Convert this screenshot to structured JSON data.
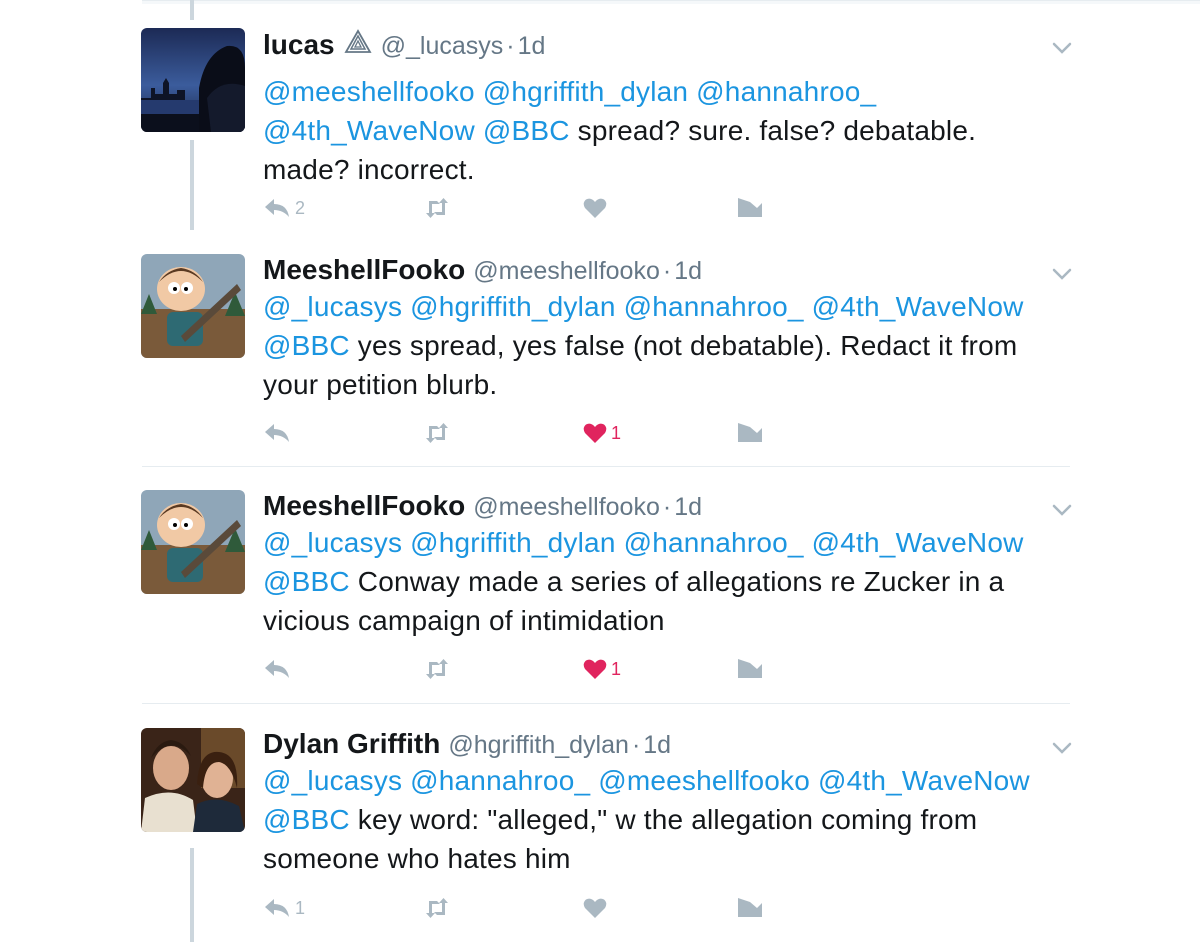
{
  "colors": {
    "link": "#1b95e0",
    "text": "#14171a",
    "muted": "#657786",
    "icon": "#aab8c2",
    "liked": "#e0245e",
    "thread_line": "#ccd6dd"
  },
  "tweets": [
    {
      "name": "lucas",
      "has_badge": true,
      "badge_icon": "paperclip-triangle-icon",
      "handle": "@_lucasys",
      "dot": "·",
      "time": "1d",
      "mentions_line1": "@meeshellfooko @hgriffith_dylan @hannahroo_",
      "mentions_line2": "@4th_WaveNow @BBC",
      "text_line2": " spread? sure. false? debatable.",
      "text_line3": "made? incorrect.",
      "reply_count": "2",
      "like_count": "",
      "liked": false
    },
    {
      "name": "MeeshellFooko",
      "handle": "@meeshellfooko",
      "dot": "·",
      "time": "1d",
      "mentions_line1": "@_lucasys @hgriffith_dylan @hannahroo_ @4th_WaveNow",
      "mentions_line2": "@BBC",
      "text_line2": " yes spread, yes false (not debatable). Redact it from",
      "text_line3": "your petition blurb.",
      "reply_count": "",
      "like_count": "1",
      "liked": true
    },
    {
      "name": "MeeshellFooko",
      "handle": "@meeshellfooko",
      "dot": "·",
      "time": "1d",
      "mentions_line1": "@_lucasys @hgriffith_dylan @hannahroo_ @4th_WaveNow",
      "mentions_line2": "@BBC",
      "text_line2": " Conway made a series of allegations re Zucker in a",
      "text_line3": "vicious campaign of intimidation",
      "reply_count": "",
      "like_count": "1",
      "liked": true
    },
    {
      "name": "Dylan Griffith",
      "handle": "@hgriffith_dylan",
      "dot": "·",
      "time": "1d",
      "mentions_line1": "@_lucasys @hannahroo_ @meeshellfooko @4th_WaveNow",
      "mentions_line2": "@BBC",
      "text_line2": " key word: \"alleged,\" w the allegation coming from",
      "text_line3": "someone who hates him",
      "reply_count": "1",
      "like_count": "",
      "liked": false
    }
  ]
}
